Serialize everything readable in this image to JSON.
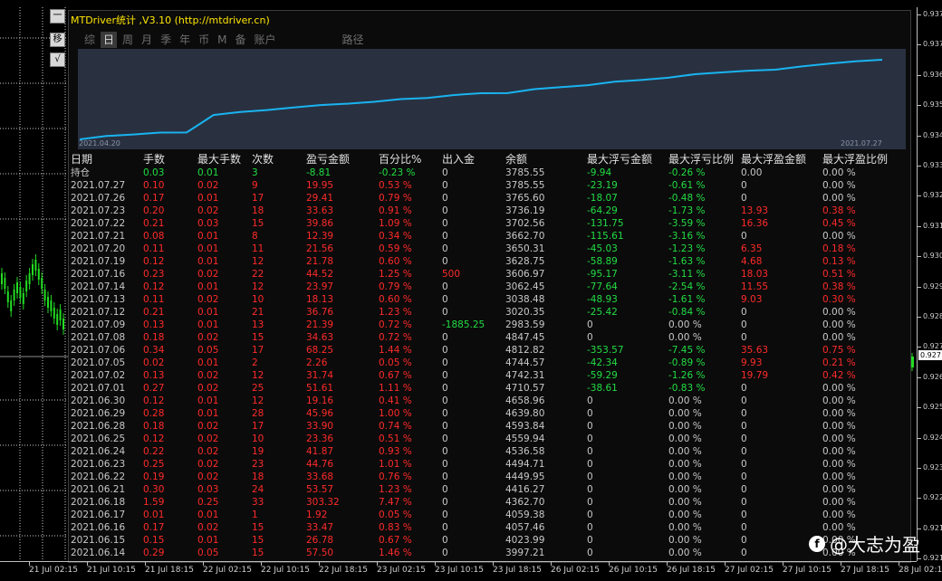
{
  "side_buttons": [
    "一",
    "移",
    "√"
  ],
  "panel_title": "MTDriver统计 ,V3.10 (http://mtdriver.cn)",
  "tabs": [
    {
      "label": "综",
      "active": false
    },
    {
      "label": "日",
      "active": true
    },
    {
      "label": "周",
      "active": false
    },
    {
      "label": "月",
      "active": false
    },
    {
      "label": "季",
      "active": false
    },
    {
      "label": "年",
      "active": false
    },
    {
      "label": "币",
      "active": false
    },
    {
      "label": "M",
      "active": false
    },
    {
      "label": "备",
      "active": false
    },
    {
      "label": "账户",
      "active": false
    },
    {
      "label": "路径",
      "active": false
    }
  ],
  "curve": {
    "start_date": "2021.04.20",
    "end_date": "2021.07.27",
    "line_color": "#19b4f0",
    "balance": [
      3997.21,
      4023.99,
      4057.46,
      4059.38,
      4362.7,
      4416.27,
      4449.95,
      4494.71,
      4536.58,
      4559.94,
      4593.84,
      4639.8,
      4658.96,
      4710.57,
      4742.31,
      4744.57,
      4812.82,
      4847.45,
      2983.59,
      3020.35,
      3038.48,
      3062.45,
      3606.97,
      3628.75,
      3650.31,
      3662.7,
      3702.56,
      3736.19,
      3765.6,
      3785.55
    ]
  },
  "table": {
    "headers": [
      "日期",
      "手数",
      "最大手数",
      "次数",
      "盈亏金额",
      "百分比%",
      "出入金",
      "余额",
      "最大浮亏金额",
      "最大浮亏比例",
      "最大浮盈金额",
      "最大浮盈比例"
    ],
    "rows": [
      [
        "持仓",
        "0.03",
        "0.01",
        "3",
        "-8.81",
        "-0.23 %",
        "0",
        "3785.55",
        "-9.94",
        "-0.26 %",
        "0.00",
        "0.00 %"
      ],
      [
        "2021.07.27",
        "0.10",
        "0.02",
        "9",
        "19.95",
        "0.53 %",
        "0",
        "3785.55",
        "-23.19",
        "-0.61 %",
        "0",
        "0.00 %"
      ],
      [
        "2021.07.26",
        "0.17",
        "0.01",
        "17",
        "29.41",
        "0.79 %",
        "0",
        "3765.60",
        "-18.07",
        "-0.48 %",
        "0",
        "0.00 %"
      ],
      [
        "2021.07.23",
        "0.20",
        "0.02",
        "18",
        "33.63",
        "0.91 %",
        "0",
        "3736.19",
        "-64.29",
        "-1.73 %",
        "13.93",
        "0.38 %"
      ],
      [
        "2021.07.22",
        "0.21",
        "0.03",
        "15",
        "39.86",
        "1.09 %",
        "0",
        "3702.56",
        "-131.75",
        "-3.59 %",
        "16.36",
        "0.45 %"
      ],
      [
        "2021.07.21",
        "0.08",
        "0.01",
        "8",
        "12.39",
        "0.34 %",
        "0",
        "3662.70",
        "-115.61",
        "-3.16 %",
        "0",
        "0.00 %"
      ],
      [
        "2021.07.20",
        "0.11",
        "0.01",
        "11",
        "21.56",
        "0.59 %",
        "0",
        "3650.31",
        "-45.03",
        "-1.23 %",
        "6.35",
        "0.18 %"
      ],
      [
        "2021.07.19",
        "0.12",
        "0.01",
        "12",
        "21.78",
        "0.60 %",
        "0",
        "3628.75",
        "-58.89",
        "-1.63 %",
        "4.68",
        "0.13 %"
      ],
      [
        "2021.07.16",
        "0.23",
        "0.02",
        "22",
        "44.52",
        "1.25 %",
        "500",
        "3606.97",
        "-95.17",
        "-3.11 %",
        "18.03",
        "0.51 %"
      ],
      [
        "2021.07.14",
        "0.12",
        "0.01",
        "12",
        "23.97",
        "0.79 %",
        "0",
        "3062.45",
        "-77.64",
        "-2.54 %",
        "11.55",
        "0.38 %"
      ],
      [
        "2021.07.13",
        "0.11",
        "0.02",
        "10",
        "18.13",
        "0.60 %",
        "0",
        "3038.48",
        "-48.93",
        "-1.61 %",
        "9.03",
        "0.30 %"
      ],
      [
        "2021.07.12",
        "0.21",
        "0.01",
        "21",
        "36.76",
        "1.23 %",
        "0",
        "3020.35",
        "-25.42",
        "-0.84 %",
        "0",
        "0.00 %"
      ],
      [
        "2021.07.09",
        "0.13",
        "0.01",
        "13",
        "21.39",
        "0.72 %",
        "-1885.25",
        "2983.59",
        "0",
        "0.00 %",
        "0",
        "0.00 %"
      ],
      [
        "2021.07.08",
        "0.18",
        "0.02",
        "15",
        "34.63",
        "0.72 %",
        "0",
        "4847.45",
        "0",
        "0.00 %",
        "0",
        "0.00 %"
      ],
      [
        "2021.07.06",
        "0.34",
        "0.05",
        "17",
        "68.25",
        "1.44 %",
        "0",
        "4812.82",
        "-353.57",
        "-7.45 %",
        "35.63",
        "0.75 %"
      ],
      [
        "2021.07.05",
        "0.02",
        "0.01",
        "2",
        "2.26",
        "0.05 %",
        "0",
        "4744.57",
        "-42.34",
        "-0.89 %",
        "9.93",
        "0.21 %"
      ],
      [
        "2021.07.02",
        "0.13",
        "0.02",
        "12",
        "31.74",
        "0.67 %",
        "0",
        "4742.31",
        "-59.29",
        "-1.26 %",
        "19.79",
        "0.42 %"
      ],
      [
        "2021.07.01",
        "0.27",
        "0.02",
        "25",
        "51.61",
        "1.11 %",
        "0",
        "4710.57",
        "-38.61",
        "-0.83 %",
        "0",
        "0.00 %"
      ],
      [
        "2021.06.30",
        "0.12",
        "0.01",
        "12",
        "19.16",
        "0.41 %",
        "0",
        "4658.96",
        "0",
        "0.00 %",
        "0",
        "0.00 %"
      ],
      [
        "2021.06.29",
        "0.28",
        "0.01",
        "28",
        "45.96",
        "1.00 %",
        "0",
        "4639.80",
        "0",
        "0.00 %",
        "0",
        "0.00 %"
      ],
      [
        "2021.06.28",
        "0.18",
        "0.02",
        "17",
        "33.90",
        "0.74 %",
        "0",
        "4593.84",
        "0",
        "0.00 %",
        "0",
        "0.00 %"
      ],
      [
        "2021.06.25",
        "0.12",
        "0.02",
        "10",
        "23.36",
        "0.51 %",
        "0",
        "4559.94",
        "0",
        "0.00 %",
        "0",
        "0.00 %"
      ],
      [
        "2021.06.24",
        "0.22",
        "0.02",
        "19",
        "41.87",
        "0.93 %",
        "0",
        "4536.58",
        "0",
        "0.00 %",
        "0",
        "0.00 %"
      ],
      [
        "2021.06.23",
        "0.25",
        "0.02",
        "23",
        "44.76",
        "1.01 %",
        "0",
        "4494.71",
        "0",
        "0.00 %",
        "0",
        "0.00 %"
      ],
      [
        "2021.06.22",
        "0.19",
        "0.02",
        "18",
        "33.68",
        "0.76 %",
        "0",
        "4449.95",
        "0",
        "0.00 %",
        "0",
        "0.00 %"
      ],
      [
        "2021.06.21",
        "0.30",
        "0.03",
        "24",
        "53.57",
        "1.23 %",
        "0",
        "4416.27",
        "0",
        "0.00 %",
        "0",
        "0.00 %"
      ],
      [
        "2021.06.18",
        "1.59",
        "0.25",
        "33",
        "303.32",
        "7.47 %",
        "0",
        "4362.70",
        "0",
        "0.00 %",
        "0",
        "0.00 %"
      ],
      [
        "2021.06.17",
        "0.01",
        "0.01",
        "1",
        "1.92",
        "0.05 %",
        "0",
        "4059.38",
        "0",
        "0.00 %",
        "0",
        "0.00 %"
      ],
      [
        "2021.06.16",
        "0.17",
        "0.02",
        "15",
        "33.47",
        "0.83 %",
        "0",
        "4057.46",
        "0",
        "0.00 %",
        "0",
        "0.00 %"
      ],
      [
        "2021.06.15",
        "0.15",
        "0.01",
        "15",
        "26.78",
        "0.67 %",
        "0",
        "4023.99",
        "0",
        "0.00 %",
        "0",
        "0.00 %"
      ],
      [
        "2021.06.14",
        "0.29",
        "0.05",
        "15",
        "57.50",
        "1.46 %",
        "0",
        "3997.21",
        "0",
        "0.00 %",
        "0",
        "0.00 %"
      ]
    ]
  },
  "price_axis": {
    "ticks": [
      "0.937",
      "0.937",
      "0.936",
      "0.935",
      "0.934",
      "0.933",
      "0.932",
      "0.931",
      "0.930",
      "0.929",
      "0.928",
      "0.927",
      "0.926",
      "0.925",
      "0.924",
      "0.923",
      "0.922",
      "0.921",
      "0.921"
    ],
    "current": "0.927"
  },
  "time_axis": {
    "ticks": [
      "21 Jul 02:15",
      "21 Jul 10:15",
      "21 Jul 18:15",
      "22 Jul 02:15",
      "22 Jul 10:15",
      "22 Jul 18:15",
      "23 Jul 02:15",
      "23 Jul 10:15",
      "23 Jul 18:15",
      "26 Jul 02:15",
      "26 Jul 10:15",
      "26 Jul 18:15",
      "27 Jul 02:15",
      "27 Jul 10:15",
      "27 Jul 18:15",
      "28 Jul 02:15"
    ]
  },
  "watermark": {
    "icon": "f",
    "text": "@大志为盈"
  }
}
